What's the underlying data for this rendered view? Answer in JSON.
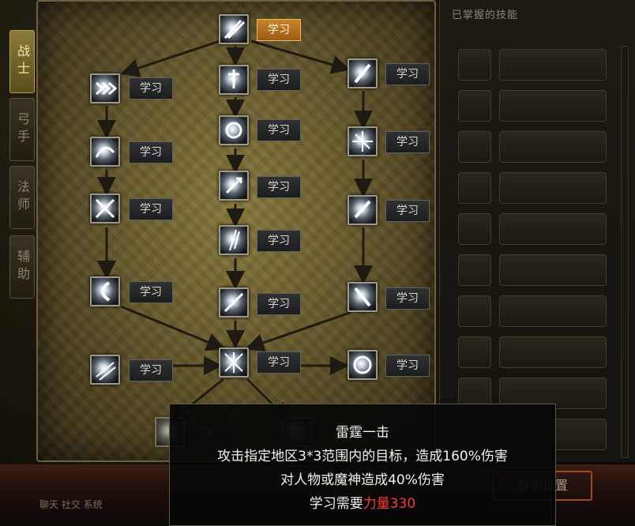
{
  "tabs": [
    {
      "label": "战士",
      "active": true
    },
    {
      "label": "弓手",
      "active": false
    },
    {
      "label": "法师",
      "active": false
    },
    {
      "label": "辅助",
      "active": false
    }
  ],
  "learn_label": "学习",
  "mastered": {
    "title": "已掌握的技能",
    "settings_button": "技能设置"
  },
  "bottom_hint": "聊天 社交 系统",
  "tooltip": {
    "name": "雷霆一击",
    "line1": "攻击指定地区3*3范围内的目标，造成160%伤害",
    "line2": "对人物或魔神造成40%伤害",
    "requirement_prefix": "学习需要",
    "requirement_value": "力量330"
  },
  "skill_icons": [
    "twin-sword-icon",
    "triple-arrow-icon",
    "sword-down-icon",
    "feather-blade-icon",
    "whirl-slash-icon",
    "spiral-slash-icon",
    "spark-burst-icon",
    "crossed-blade-icon",
    "flame-dagger-icon",
    "holy-sword-icon",
    "light-beam-icon",
    "claw-strike-icon",
    "crescent-icon",
    "sword-flash-icon",
    "fall-sword-icon",
    "wind-slash-icon",
    "thunder-strike-icon",
    "orb-icon",
    "ghost-icon",
    "shield-icon"
  ],
  "colors": {
    "accent": "#c8832b",
    "requirement": "#ff3a2e"
  }
}
